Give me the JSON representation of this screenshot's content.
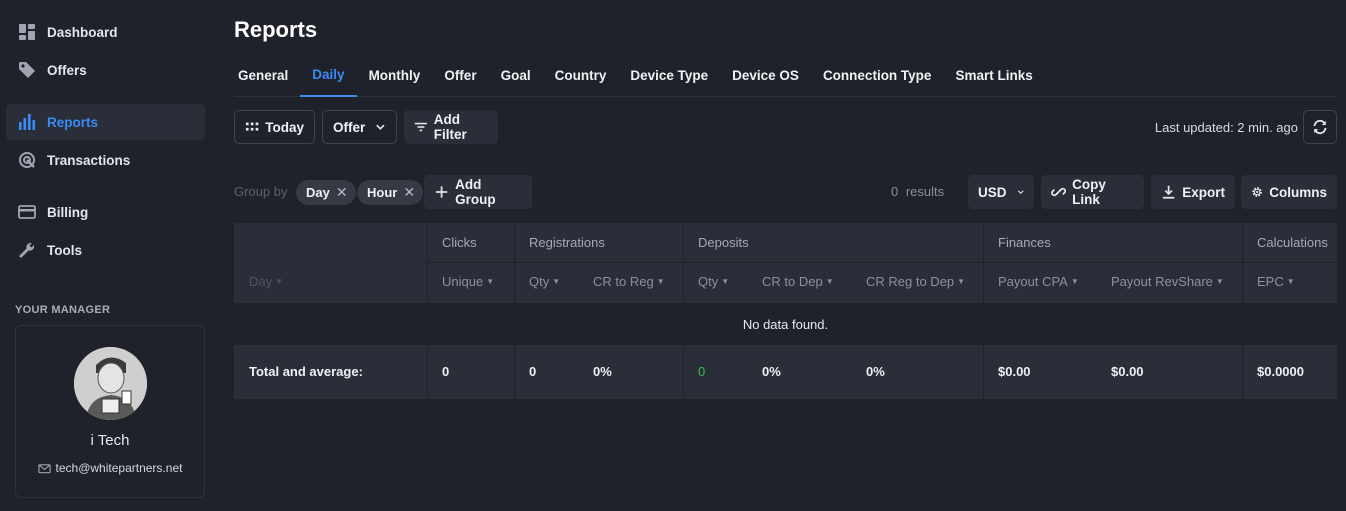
{
  "sidebar": {
    "items": [
      {
        "label": "Dashboard",
        "icon": "dashboard-icon"
      },
      {
        "label": "Offers",
        "icon": "tag-icon"
      },
      {
        "label": "Reports",
        "icon": "bar-chart-icon",
        "active": true
      },
      {
        "label": "Transactions",
        "icon": "transactions-icon"
      },
      {
        "label": "Billing",
        "icon": "credit-card-icon"
      },
      {
        "label": "Tools",
        "icon": "wrench-icon"
      }
    ],
    "manager_label": "YOUR MANAGER",
    "manager": {
      "name": "i Tech",
      "email": "tech@whitepartners.net"
    }
  },
  "page": {
    "title": "Reports",
    "tabs": [
      "General",
      "Daily",
      "Monthly",
      "Offer",
      "Goal",
      "Country",
      "Device Type",
      "Device OS",
      "Connection Type",
      "Smart Links"
    ],
    "active_tab": "Daily"
  },
  "filters": {
    "date": "Today",
    "offer": "Offer",
    "add_filter": "Add Filter",
    "last_updated": "Last updated: 2 min. ago"
  },
  "grouping": {
    "label": "Group by",
    "chips": [
      "Day",
      "Hour"
    ],
    "add_group": "Add Group",
    "results": "0 results",
    "currency": "USD",
    "copy_link": "Copy Link",
    "export": "Export",
    "columns": "Columns"
  },
  "table": {
    "groups": [
      "Clicks",
      "Registrations",
      "Deposits",
      "Finances",
      "Calculations"
    ],
    "headers": {
      "day": "Day",
      "unique": "Unique",
      "reg_qty": "Qty",
      "cr_to_reg": "CR to Reg",
      "dep_qty": "Qty",
      "cr_to_dep": "CR to Dep",
      "cr_reg_to_dep": "CR Reg to Dep",
      "payout_cpa": "Payout CPA",
      "payout_revshare": "Payout RevShare",
      "epc": "EPC"
    },
    "empty_message": "No data found.",
    "totals": {
      "label": "Total and average:",
      "unique": "0",
      "reg_qty": "0",
      "cr_to_reg": "0%",
      "dep_qty": "0",
      "cr_to_dep": "0%",
      "cr_reg_to_dep": "0%",
      "payout_cpa": "$0.00",
      "payout_revshare": "$0.00",
      "epc": "$0.0000"
    }
  },
  "colors": {
    "accent": "#3b8bf5",
    "positive": "#3fb950",
    "background": "#1f222b",
    "panel": "#2a2e38"
  }
}
